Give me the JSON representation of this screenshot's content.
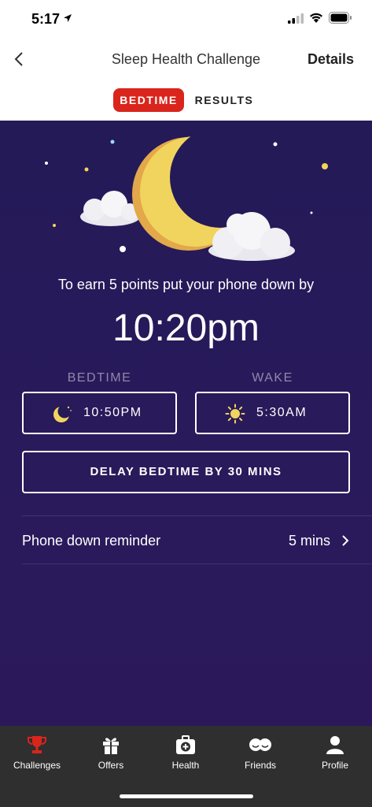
{
  "status": {
    "time": "5:17"
  },
  "nav": {
    "title": "Sleep Health Challenge",
    "details": "Details"
  },
  "tabs": [
    {
      "label": "BEDTIME",
      "active": true
    },
    {
      "label": "RESULTS",
      "active": false
    }
  ],
  "main": {
    "earn_text": "To earn 5 points put your phone down by",
    "phone_down_time": "10:20pm",
    "bedtime": {
      "label": "BEDTIME",
      "value": "10:50PM",
      "icon": "moon-icon"
    },
    "wake": {
      "label": "WAKE",
      "value": "5:30AM",
      "icon": "sun-icon"
    },
    "delay_button": "DELAY BEDTIME BY 30 MINS",
    "reminder": {
      "label": "Phone down reminder",
      "value": "5 mins"
    }
  },
  "tabbar": [
    {
      "label": "Challenges",
      "icon": "trophy-icon",
      "active": true
    },
    {
      "label": "Offers",
      "icon": "gift-icon",
      "active": false
    },
    {
      "label": "Health",
      "icon": "medical-kit-icon",
      "active": false
    },
    {
      "label": "Friends",
      "icon": "friends-icon",
      "active": false
    },
    {
      "label": "Profile",
      "icon": "profile-icon",
      "active": false
    }
  ],
  "colors": {
    "accent": "#d9251c",
    "background": "#241a58",
    "moon": "#f3d35a",
    "tabbar": "#2f2f2f"
  }
}
